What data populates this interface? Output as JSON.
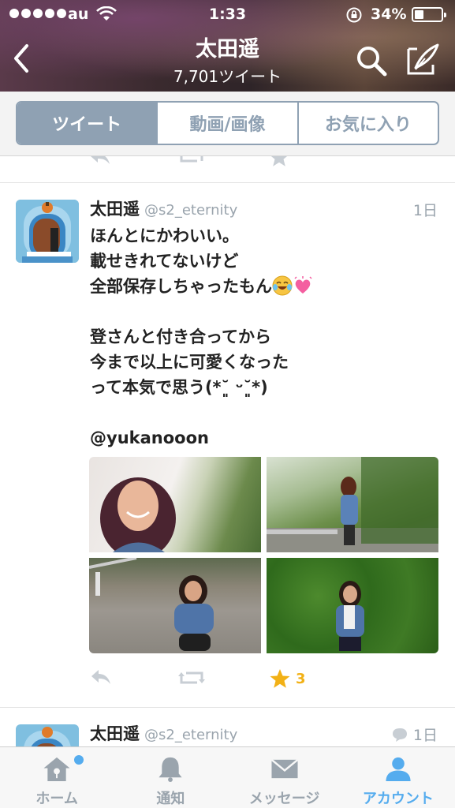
{
  "status_bar": {
    "carrier": "au",
    "time": "1:33",
    "battery_percent": "34%",
    "battery_level": 0.34
  },
  "header": {
    "title": "太田遥",
    "subtitle": "7,701ツイート"
  },
  "segments": {
    "items": [
      "ツイート",
      "動画/画像",
      "お気に入り"
    ],
    "selected": "ツイート"
  },
  "tweet": {
    "name": "太田遥",
    "handle": "@s2_eternity",
    "age": "1日",
    "lines": [
      "ほんとにかわいい。",
      "載せきれてないけど",
      "全部保存しちゃったもん",
      "",
      "登さんと付き合ってから",
      "今まで以上に可愛くなった",
      "って本気で思う(*˘͈ ᵕ˘͈*)",
      "",
      "@yukanooon"
    ],
    "favorite_count": "3"
  },
  "next_tweet": {
    "name": "太田遥",
    "handle": "@s2_eternity",
    "age": "1日"
  },
  "tabbar": {
    "items": [
      "ホーム",
      "通知",
      "メッセージ",
      "アカウント"
    ],
    "active": "アカウント"
  },
  "colors": {
    "accent": "#55acee",
    "segment": "#8fa1b3",
    "favorite": "#f2b116",
    "muted": "#9aa4ad"
  }
}
